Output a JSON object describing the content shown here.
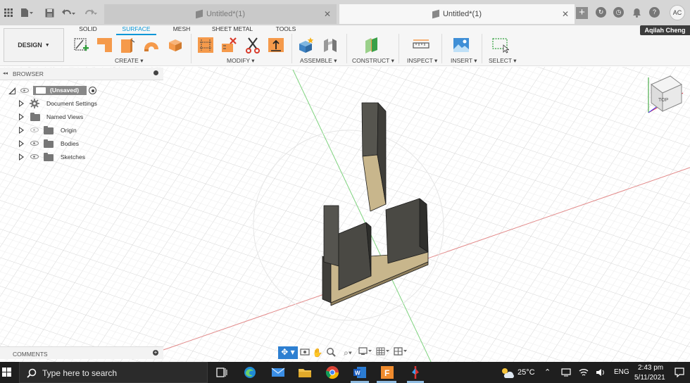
{
  "tabs": [
    {
      "label": "Untitled*(1)",
      "state": "inactive"
    },
    {
      "label": "Untitled*(1)",
      "state": "active"
    }
  ],
  "user": {
    "name": "Aqilah Cheng",
    "initials": "AC"
  },
  "ribbon": {
    "design_label": "DESIGN",
    "tabs": [
      "SOLID",
      "SURFACE",
      "MESH",
      "SHEET METAL",
      "TOOLS"
    ],
    "active_tab": "SURFACE",
    "groups": [
      "CREATE",
      "MODIFY",
      "ASSEMBLE",
      "CONSTRUCT",
      "INSPECT",
      "INSERT",
      "SELECT"
    ]
  },
  "browser": {
    "title": "BROWSER",
    "root": "(Unsaved)",
    "items": [
      "Document Settings",
      "Named Views",
      "Origin",
      "Bodies",
      "Sketches"
    ]
  },
  "comments": {
    "title": "COMMENTS"
  },
  "viewcube": {
    "face": "TOP"
  },
  "taskbar": {
    "search_placeholder": "Type here to search",
    "temperature": "25°C",
    "language": "ENG",
    "time": "2:43 pm",
    "date": "5/11/2021"
  },
  "colors": {
    "accent": "#0696d7",
    "surface_orange": "#f59a4b",
    "body_dark": "#4a4a46",
    "body_tan": "#c8b68c"
  }
}
